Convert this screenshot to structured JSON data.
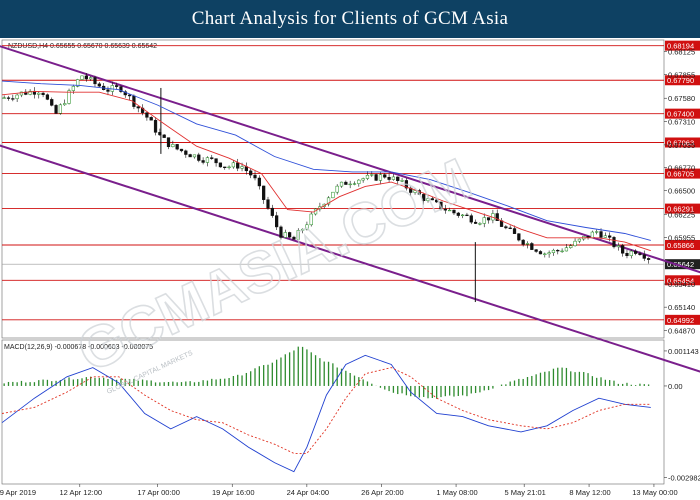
{
  "banner": {
    "title": "Chart Analysis for Clients of GCM Asia"
  },
  "watermark": "GCMASIA.COM",
  "watermark_small": "GLOBAL CAPITAL MARKETS",
  "chart_data": {
    "type": "candlestick",
    "price_panel": {
      "header": "NZDUSD,H4   0.65655 0.65670 0.65639 0.65642",
      "ylim": [
        0.6478,
        0.6826
      ],
      "y_ticks": [
        {
          "v": 0.68125,
          "t": "0.68125"
        },
        {
          "v": 0.67855,
          "t": "0.67855"
        },
        {
          "v": 0.6758,
          "t": "0.67580"
        },
        {
          "v": 0.6731,
          "t": "0.67310"
        },
        {
          "v": 0.67035,
          "t": "0.67035"
        },
        {
          "v": 0.6677,
          "t": "0.66770"
        },
        {
          "v": 0.665,
          "t": "0.66500"
        },
        {
          "v": 0.66225,
          "t": "0.66225"
        },
        {
          "v": 0.65955,
          "t": "0.65955"
        },
        {
          "v": 0.6541,
          "t": "0.65410"
        },
        {
          "v": 0.6514,
          "t": "0.65140"
        },
        {
          "v": 0.6487,
          "t": "0.64870"
        }
      ],
      "resistance_support_levels": [
        {
          "v": 0.68194,
          "t": "0.68194"
        },
        {
          "v": 0.6779,
          "t": "0.67790"
        },
        {
          "v": 0.674,
          "t": "0.67400"
        },
        {
          "v": 0.67063,
          "t": "0.67063"
        },
        {
          "v": 0.667,
          "t": "0.66705"
        },
        {
          "v": 0.66291,
          "t": "0.66291"
        },
        {
          "v": 0.65866,
          "t": "0.65866"
        },
        {
          "v": 0.65454,
          "t": "0.65454"
        },
        {
          "v": 0.64992,
          "t": "0.64992"
        }
      ],
      "current_price": {
        "v": 0.65642,
        "t": "0.65642"
      },
      "channel": {
        "upper": {
          "from": [
            0,
            0.6818
          ],
          "to": [
            100,
            0.6571
          ]
        },
        "lower": {
          "from": [
            0,
            0.6702
          ],
          "to": [
            100,
            0.6455
          ]
        }
      },
      "close_path": [
        [
          0,
          0.6758
        ],
        [
          3,
          0.6764
        ],
        [
          6,
          0.6768
        ],
        [
          8,
          0.6738
        ],
        [
          10,
          0.6762
        ],
        [
          12,
          0.6785
        ],
        [
          14,
          0.6775
        ],
        [
          16,
          0.6768
        ],
        [
          18,
          0.677
        ],
        [
          20,
          0.6752
        ],
        [
          22,
          0.6735
        ],
        [
          24,
          0.6712
        ],
        [
          26,
          0.67
        ],
        [
          28,
          0.6694
        ],
        [
          30,
          0.6688
        ],
        [
          32,
          0.6685
        ],
        [
          34,
          0.6678
        ],
        [
          36,
          0.668
        ],
        [
          38,
          0.6666
        ],
        [
          40,
          0.6632
        ],
        [
          42,
          0.66
        ],
        [
          44,
          0.6592
        ],
        [
          46,
          0.6612
        ],
        [
          48,
          0.6632
        ],
        [
          50,
          0.665
        ],
        [
          52,
          0.666
        ],
        [
          54,
          0.6664
        ],
        [
          56,
          0.6665
        ],
        [
          58,
          0.6668
        ],
        [
          60,
          0.666
        ],
        [
          62,
          0.665
        ],
        [
          64,
          0.664
        ],
        [
          66,
          0.6632
        ],
        [
          68,
          0.6625
        ],
        [
          70,
          0.662
        ],
        [
          72,
          0.6615
        ],
        [
          74,
          0.662
        ],
        [
          76,
          0.6606
        ],
        [
          78,
          0.6595
        ],
        [
          80,
          0.6585
        ],
        [
          82,
          0.6577
        ],
        [
          84,
          0.658
        ],
        [
          86,
          0.6586
        ],
        [
          88,
          0.6595
        ],
        [
          90,
          0.6603
        ],
        [
          92,
          0.659
        ],
        [
          94,
          0.6576
        ],
        [
          96,
          0.6581
        ],
        [
          98,
          0.657
        ],
        [
          100,
          0.6564
        ]
      ],
      "ma_fast_path": [
        [
          0,
          0.6762
        ],
        [
          5,
          0.6766
        ],
        [
          10,
          0.6765
        ],
        [
          15,
          0.6765
        ],
        [
          20,
          0.6755
        ],
        [
          25,
          0.6728
        ],
        [
          30,
          0.6702
        ],
        [
          35,
          0.6688
        ],
        [
          40,
          0.667
        ],
        [
          44,
          0.6628
        ],
        [
          48,
          0.6625
        ],
        [
          52,
          0.6643
        ],
        [
          56,
          0.6655
        ],
        [
          60,
          0.666
        ],
        [
          64,
          0.665
        ],
        [
          68,
          0.6638
        ],
        [
          72,
          0.6628
        ],
        [
          76,
          0.6618
        ],
        [
          80,
          0.6605
        ],
        [
          84,
          0.6595
        ],
        [
          88,
          0.6595
        ],
        [
          92,
          0.6595
        ],
        [
          96,
          0.659
        ],
        [
          100,
          0.658
        ]
      ],
      "ma_slow_path": [
        [
          0,
          0.6778
        ],
        [
          6,
          0.6775
        ],
        [
          12,
          0.6773
        ],
        [
          18,
          0.6768
        ],
        [
          24,
          0.675
        ],
        [
          30,
          0.6728
        ],
        [
          36,
          0.6715
        ],
        [
          42,
          0.669
        ],
        [
          48,
          0.6675
        ],
        [
          54,
          0.6672
        ],
        [
          60,
          0.6672
        ],
        [
          66,
          0.6663
        ],
        [
          72,
          0.6648
        ],
        [
          78,
          0.6632
        ],
        [
          84,
          0.6615
        ],
        [
          90,
          0.6607
        ],
        [
          96,
          0.66
        ],
        [
          100,
          0.6592
        ]
      ],
      "spikes": [
        {
          "x": 24,
          "low": 0.6693,
          "high": 0.677
        },
        {
          "x": 71.5,
          "low": 0.652,
          "high": 0.659
        }
      ]
    },
    "macd_panel": {
      "header": "MACD(12,26,9)  -0.000678  -0.000603  -0.000075",
      "ylim": [
        -0.0032,
        0.0015
      ],
      "y_ticks": [
        {
          "v": 0.001143,
          "t": "0.001143"
        },
        {
          "v": 0.0,
          "t": "0.00"
        },
        {
          "v": -0.002982,
          "t": "-0.002982"
        }
      ],
      "histogram_profile": [
        [
          0,
          0.0001
        ],
        [
          8,
          0.0002
        ],
        [
          14,
          0.0003
        ],
        [
          20,
          0.0002
        ],
        [
          28,
          0.0001
        ],
        [
          36,
          0.0003
        ],
        [
          42,
          0.0008
        ],
        [
          46,
          0.0013
        ],
        [
          49,
          0.0009
        ],
        [
          54,
          0.0004
        ],
        [
          60,
          -0.0002
        ],
        [
          66,
          -0.0004
        ],
        [
          72,
          -0.0003
        ],
        [
          78,
          0.0001
        ],
        [
          83,
          0.0004
        ],
        [
          86,
          0.0006
        ],
        [
          90,
          0.0004
        ],
        [
          95,
          0.0001
        ],
        [
          100,
          2e-05
        ]
      ],
      "macd_line": [
        [
          0,
          -0.0012
        ],
        [
          5,
          -0.0004
        ],
        [
          10,
          0.0003
        ],
        [
          14,
          0.0006
        ],
        [
          18,
          0.0001
        ],
        [
          22,
          -0.0009
        ],
        [
          26,
          -0.0014
        ],
        [
          30,
          -0.001
        ],
        [
          34,
          -0.0014
        ],
        [
          38,
          -0.002
        ],
        [
          42,
          -0.0025
        ],
        [
          45,
          -0.0028
        ],
        [
          47,
          -0.002
        ],
        [
          50,
          -0.0003
        ],
        [
          53,
          0.0007
        ],
        [
          56,
          0.001
        ],
        [
          60,
          0.0007
        ],
        [
          63,
          -0.0002
        ],
        [
          67,
          -0.0009
        ],
        [
          71,
          -0.001
        ],
        [
          75,
          -0.0013
        ],
        [
          80,
          -0.0015
        ],
        [
          84,
          -0.0013
        ],
        [
          88,
          -0.0008
        ],
        [
          92,
          -0.0004
        ],
        [
          96,
          -0.0006
        ],
        [
          100,
          -0.0007
        ]
      ],
      "signal_line": [
        [
          0,
          -0.0009
        ],
        [
          5,
          -0.0007
        ],
        [
          10,
          -0.0002
        ],
        [
          14,
          0.0003
        ],
        [
          18,
          0.0003
        ],
        [
          22,
          -0.0003
        ],
        [
          26,
          -0.0008
        ],
        [
          30,
          -0.0011
        ],
        [
          34,
          -0.0012
        ],
        [
          38,
          -0.0016
        ],
        [
          42,
          -0.0019
        ],
        [
          45,
          -0.0022
        ],
        [
          47,
          -0.0022
        ],
        [
          50,
          -0.0014
        ],
        [
          53,
          -0.0004
        ],
        [
          56,
          0.0004
        ],
        [
          60,
          0.0006
        ],
        [
          63,
          0.0003
        ],
        [
          67,
          -0.0004
        ],
        [
          71,
          -0.0008
        ],
        [
          75,
          -0.0011
        ],
        [
          80,
          -0.0013
        ],
        [
          84,
          -0.0014
        ],
        [
          88,
          -0.0012
        ],
        [
          92,
          -0.0008
        ],
        [
          96,
          -0.0006
        ],
        [
          100,
          -0.0006
        ]
      ]
    },
    "x_ticks": [
      {
        "x": 0,
        "t": "9 Apr 2019"
      },
      {
        "x": 12.5,
        "t": "12 Apr 12:00"
      },
      {
        "x": 24.5,
        "t": "17 Apr 00:00"
      },
      {
        "x": 36,
        "t": "19 Apr 16:00"
      },
      {
        "x": 47.5,
        "t": "24 Apr 04:00"
      },
      {
        "x": 59,
        "t": "26 Apr 20:00"
      },
      {
        "x": 70.5,
        "t": "1 May 08:00"
      },
      {
        "x": 81,
        "t": "5 May 21:01"
      },
      {
        "x": 91,
        "t": "8 May 12:00"
      },
      {
        "x": 101,
        "t": "13 May 00:00"
      }
    ],
    "colors": {
      "banner": "#0e4163",
      "level_line": "#d01010",
      "level_label_bg": "#d01010",
      "channel": "#7a1f8c",
      "ma_fast": "#e03030",
      "ma_slow": "#3050d8",
      "macd_hist": "#2e8b2e",
      "macd_line": "#2040d0",
      "signal_line": "#e03020",
      "current_price_bg": "#202020"
    }
  }
}
